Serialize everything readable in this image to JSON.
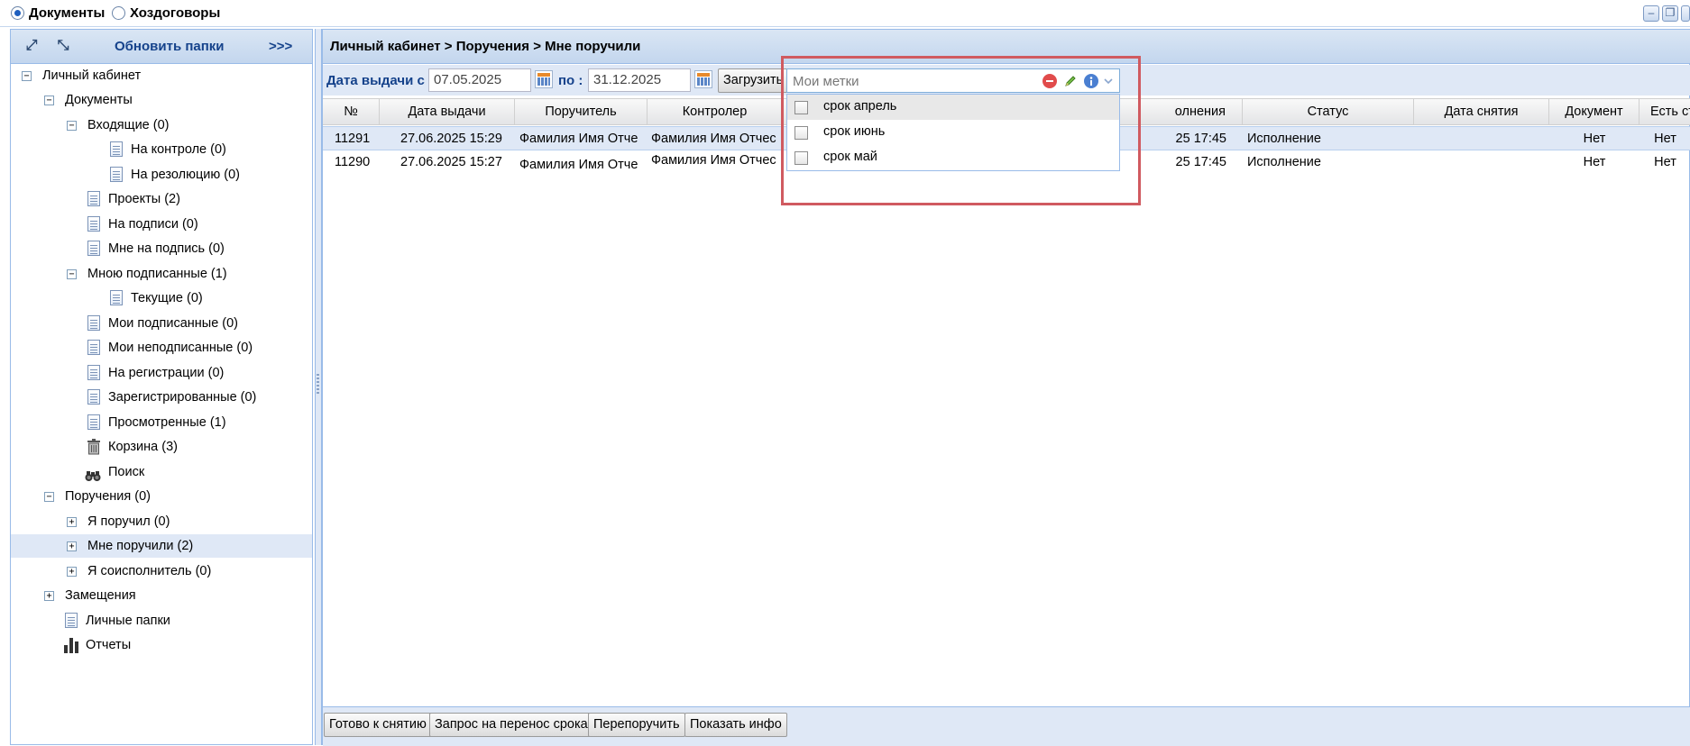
{
  "top": {
    "radio_documents": "Документы",
    "radio_contracts": "Хоздоговоры"
  },
  "left": {
    "refresh_label": "Обновить папки",
    "expand_label": ">>>",
    "tree": [
      {
        "label": "Личный кабинет",
        "toggle": "−"
      },
      {
        "label": "Документы",
        "toggle": "−"
      },
      {
        "label": "Входящие (0)",
        "toggle": "−"
      },
      {
        "label": "На контроле (0)"
      },
      {
        "label": "На резолюцию (0)"
      },
      {
        "label": "Проекты (2)"
      },
      {
        "label": "На подписи (0)"
      },
      {
        "label": "Мне на подпись (0)"
      },
      {
        "label": "Мною подписанные (1)",
        "toggle": "−"
      },
      {
        "label": "Текущие (0)"
      },
      {
        "label": "Мои подписанные (0)"
      },
      {
        "label": "Мои неподписанные (0)"
      },
      {
        "label": "На регистрации (0)"
      },
      {
        "label": "Зарегистрированные (0)"
      },
      {
        "label": "Просмотренные (1)"
      },
      {
        "label": "Корзина (3)"
      },
      {
        "label": "Поиск"
      },
      {
        "label": "Поручения (0)",
        "toggle": "−"
      },
      {
        "label": "Я поручил (0)",
        "toggle": "+"
      },
      {
        "label": "Мне поручили (2)",
        "toggle": "+"
      },
      {
        "label": "Я соисполнитель (0)",
        "toggle": "+"
      },
      {
        "label": "Замещения",
        "toggle": "+"
      },
      {
        "label": "Личные папки"
      },
      {
        "label": "Отчеты"
      }
    ]
  },
  "main": {
    "breadcrumb": "Личный кабинет > Поручения > Мне поручили",
    "filter": {
      "date_from_label": "Дата выдачи с :",
      "date_from": "07.05.2025",
      "date_to_label": "по :",
      "date_to": "31.12.2025",
      "load_button": "Загрузить"
    },
    "tags": {
      "placeholder": "Мои метки",
      "options": [
        "срок апрель",
        "срок июнь",
        "срок май"
      ]
    },
    "columns": [
      "№",
      "Дата выдачи",
      "Поручитель",
      "Контролер",
      "олнения",
      "Статус",
      "Дата снятия",
      "Документ",
      "Есть старшее?"
    ],
    "rows": [
      {
        "num": "11291",
        "date": "27.06.2025 15:29",
        "issuer": "Фамилия Имя Отче",
        "controller": "Фамилия Имя Отчес",
        "deadline": "25 17:45",
        "status": "Исполнение",
        "removed": "",
        "document": "Нет",
        "senior": "Нет"
      },
      {
        "num": "11290",
        "date": "27.06.2025 15:27",
        "issuer": "Фамилия Имя Отче",
        "controller": "Фамилия Имя Отчес",
        "deadline": "25 17:45",
        "status": "Исполнение",
        "removed": "",
        "document": "Нет",
        "senior": "Нет"
      }
    ],
    "bottom_buttons": [
      "Готово к снятию",
      "Запрос на перенос срока",
      "Перепоручить",
      "Показать инфо"
    ]
  }
}
